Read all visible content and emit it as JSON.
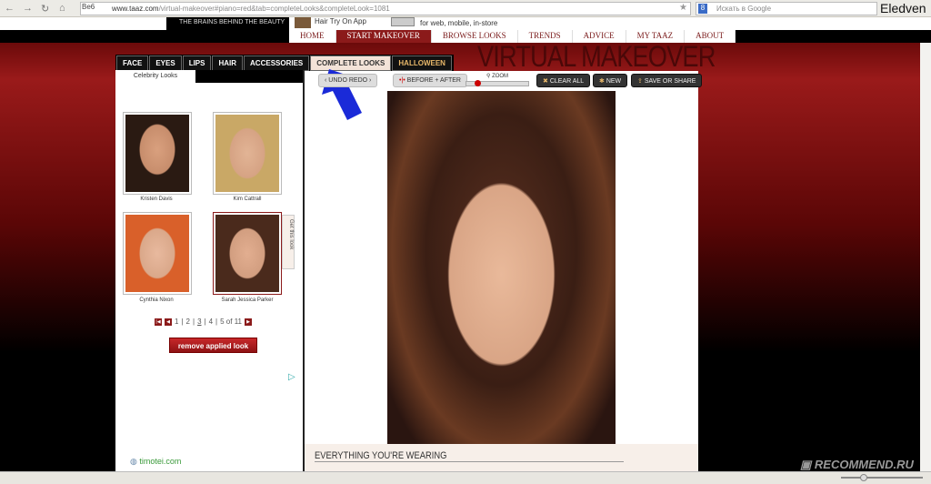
{
  "browser": {
    "ssl_label": "Ве6",
    "url_host": "www.taaz.com",
    "url_path": "/virtual-makeover#piano=red&tab=completeLooks&completeLook=1081",
    "search_placeholder": "Искать в Google",
    "user": "Eledven"
  },
  "header": {
    "logo_tagline": "THE BRAINS BEHIND THE BEAUTY",
    "hair_app": "Hair Try On App",
    "web_text": "for web, mobile, in-store"
  },
  "nav": [
    "HOME",
    "START MAKEOVER",
    "BROWSE LOOKS",
    "TRENDS",
    "ADVICE",
    "MY TAAZ",
    "ABOUT"
  ],
  "title": "VIRTUAL MAKEOVER",
  "tabs": [
    "FACE",
    "EYES",
    "LIPS",
    "HAIR",
    "ACCESSORIES",
    "COMPLETE LOOKS",
    "HALLOWEEN"
  ],
  "left": {
    "section": "Celebrity Looks",
    "celebs": [
      "Kristen Davis",
      "Kim Cattrall",
      "Cynthia Nixon",
      "Sarah Jessica Parker"
    ],
    "get_look": "Get this look",
    "pages": [
      "1",
      "2",
      "3",
      "4",
      "5 of 11"
    ],
    "current_page": "3",
    "remove": "remove applied look",
    "ad": "timotei.com"
  },
  "toolbar": {
    "undo": "UNDO",
    "redo": "REDO",
    "before_after": "BEFORE + AFTER",
    "zoom": "ZOOM",
    "clear": "CLEAR ALL",
    "new": "NEW",
    "save": "SAVE OR SHARE"
  },
  "wearing": "EVERYTHING YOU'RE WEARING",
  "watermark": "RECOMMEND.RU",
  "colors": {
    "accent": "#8b1a1a",
    "arrow": "#1a2ad8"
  }
}
